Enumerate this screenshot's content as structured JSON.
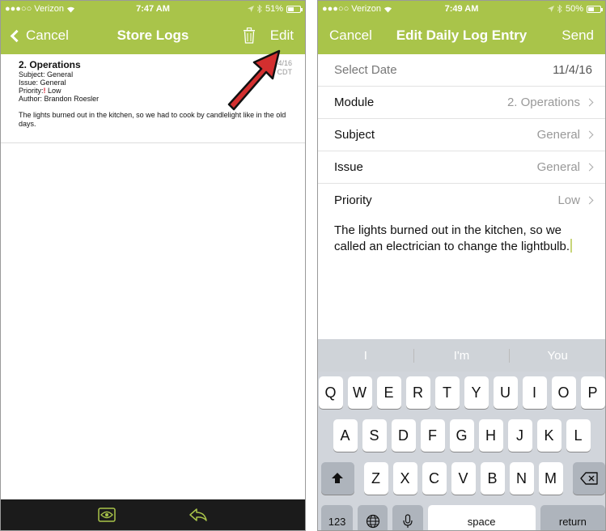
{
  "left": {
    "status": {
      "carrier": "●●●○○ Verizon",
      "time": "7:47 AM",
      "battery": "51%",
      "battery_level": 0.51
    },
    "nav": {
      "cancel": "Cancel",
      "title": "Store Logs",
      "edit": "Edit"
    },
    "log": {
      "module": "2. Operations",
      "subject_label": "Subject:",
      "subject": "General",
      "issue_label": "Issue:",
      "issue": "General",
      "priority_label": "Priority:",
      "priority_mark": "!",
      "priority": "Low",
      "author_label": "Author:",
      "author": "Brandon Roesler",
      "date": "/4/16",
      "time_zone": "M CDT",
      "body": "The lights burned out in the kitchen, so we had to cook by candlelight like in the old days."
    },
    "colors": {
      "brand": "#a9c44a",
      "arrow": "#d32f2f",
      "toolbar": "#1b1b1b",
      "toolbar_icon": "#a9c44a"
    }
  },
  "right": {
    "status": {
      "carrier": "●●●○○ Verizon",
      "time": "7:49 AM",
      "battery": "50%",
      "battery_level": 0.5
    },
    "nav": {
      "cancel": "Cancel",
      "title": "Edit Daily Log Entry",
      "send": "Send"
    },
    "rows": [
      {
        "label": "Select Date",
        "value": "11/4/16"
      },
      {
        "label": "Module",
        "value": "2. Operations"
      },
      {
        "label": "Subject",
        "value": "General"
      },
      {
        "label": "Issue",
        "value": "General"
      },
      {
        "label": "Priority",
        "value": "Low"
      }
    ],
    "notes": "The lights burned out in the kitchen, so we called an electrician to change the lightbulb.",
    "suggestions": [
      "I",
      "I'm",
      "You"
    ],
    "keyboard": {
      "row1": [
        "Q",
        "W",
        "E",
        "R",
        "T",
        "Y",
        "U",
        "I",
        "O",
        "P"
      ],
      "row2": [
        "A",
        "S",
        "D",
        "F",
        "G",
        "H",
        "J",
        "K",
        "L"
      ],
      "row3": [
        "Z",
        "X",
        "C",
        "V",
        "B",
        "N",
        "M"
      ],
      "num_key": "123",
      "space_key": "space",
      "return_key": "return"
    }
  }
}
